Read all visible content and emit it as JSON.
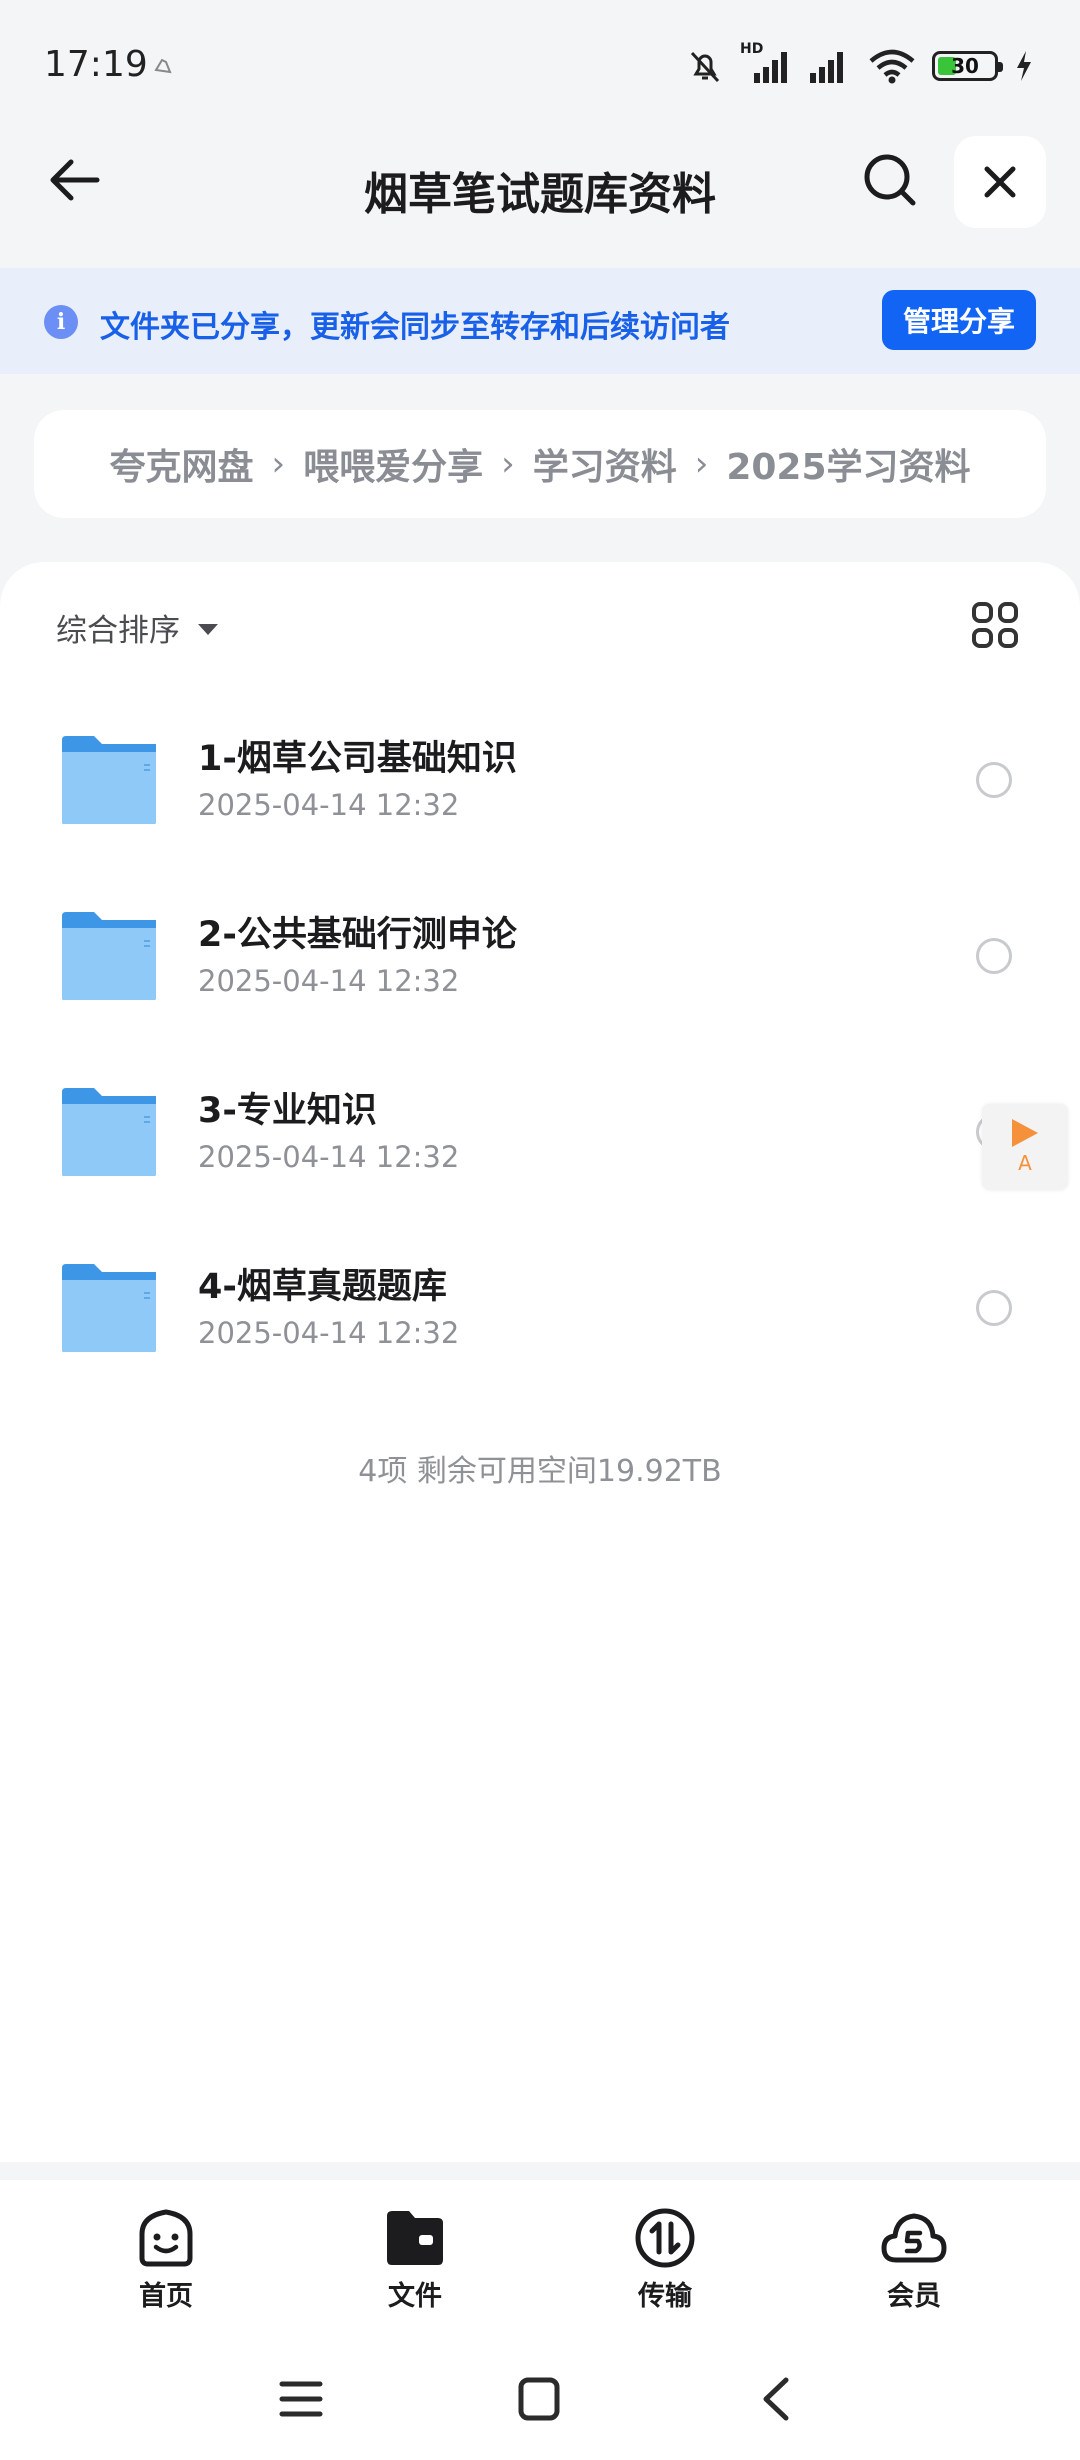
{
  "status_bar": {
    "time": "17:19",
    "battery": "30",
    "network_badge": "HD"
  },
  "header": {
    "title": "烟草笔试题库资料"
  },
  "share_banner": {
    "message": "文件夹已分享，更新会同步至转存和后续访问者",
    "manage_label": "管理分享"
  },
  "breadcrumb": [
    "夸克网盘",
    "喂喂爱分享",
    "学习资料",
    "2025学习资料"
  ],
  "toolbar": {
    "sort_label": "综合排序"
  },
  "folders": [
    {
      "name": "1-烟草公司基础知识",
      "date": "2025-04-14 12:32"
    },
    {
      "name": "2-公共基础行测申论",
      "date": "2025-04-14 12:32"
    },
    {
      "name": "3-专业知识",
      "date": "2025-04-14 12:32"
    },
    {
      "name": "4-烟草真题题库",
      "date": "2025-04-14 12:32"
    }
  ],
  "summary": "4项 剩余可用空间19.92TB",
  "float_button": {
    "label": "A"
  },
  "bottom_nav": [
    {
      "label": "首页",
      "icon": "home-face-icon"
    },
    {
      "label": "文件",
      "icon": "folder-icon"
    },
    {
      "label": "传输",
      "icon": "transfer-icon"
    },
    {
      "label": "会员",
      "icon": "cloud-member-icon"
    }
  ],
  "colors": {
    "accent": "#1264f5",
    "banner_bg": "#e9eefb",
    "folder": "#5aaaf0"
  }
}
